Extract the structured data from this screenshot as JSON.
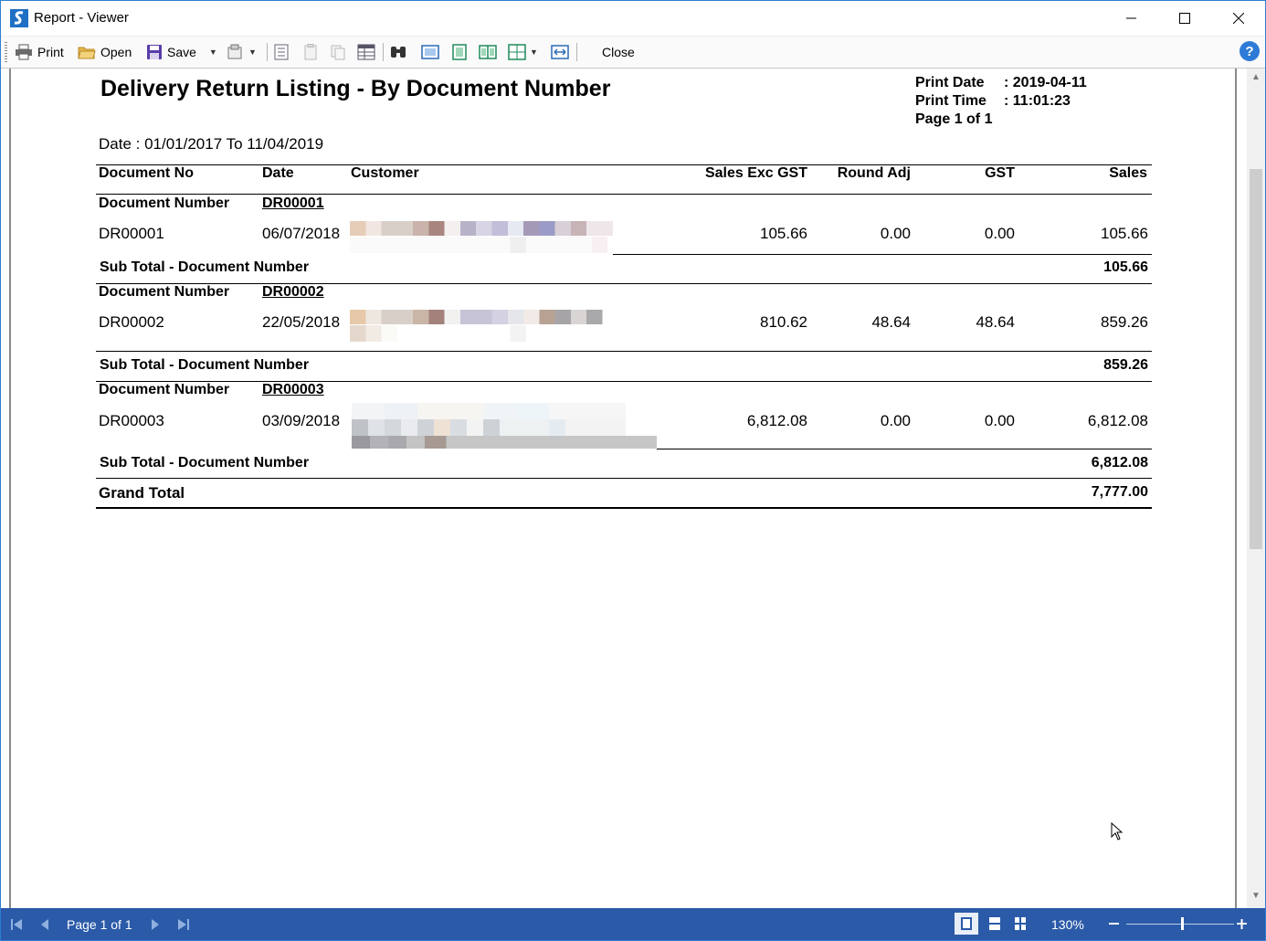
{
  "window": {
    "title": "Report - Viewer",
    "brand_color": "#2b7fd4",
    "buttons": [
      "minimize-icon",
      "maximize-icon",
      "close-icon"
    ]
  },
  "toolbar": {
    "print_label": "Print",
    "open_label": "Open",
    "save_label": "Save",
    "close_label": "Close",
    "help_label": "?"
  },
  "report": {
    "title": "Delivery Return Listing - By Document Number",
    "print_date_label": "Print Date",
    "print_date_value": ": 2019-04-11",
    "print_time_label": "Print Time",
    "print_time_value": ": 11:01:23",
    "page_info": "Page 1 of 1",
    "date_range": "Date : 01/01/2017 To 11/04/2019",
    "columns": [
      "Document No",
      "Date",
      "Customer",
      "Sales Exc GST",
      "Round Adj",
      "GST",
      "Sales"
    ],
    "group_label": "Document Number",
    "subtotal_label": "Sub Total - Document Number",
    "grand_total_label": "Grand Total",
    "grand_total": "7,777.00",
    "groups": [
      {
        "group": "DR00001",
        "doc_no": "DR00001",
        "date": "06/07/2018",
        "sales_exc_gst": "105.66",
        "round_adj": "0.00",
        "gst": "0.00",
        "sales": "105.66",
        "subtotal": "105.66"
      },
      {
        "group": "DR00002",
        "doc_no": "DR00002",
        "date": "22/05/2018",
        "sales_exc_gst": "810.62",
        "round_adj": "48.64",
        "gst": "48.64",
        "sales": "859.26",
        "subtotal": "859.26"
      },
      {
        "group": "DR00003",
        "doc_no": "DR00003",
        "date": "03/09/2018",
        "sales_exc_gst": "6,812.08",
        "round_adj": "0.00",
        "gst": "0.00",
        "sales": "6,812.08",
        "subtotal": "6,812.08"
      }
    ]
  },
  "statusbar": {
    "page_label": "Page 1 of 1",
    "zoom": "130%",
    "bg_color": "#2b5aa8"
  }
}
